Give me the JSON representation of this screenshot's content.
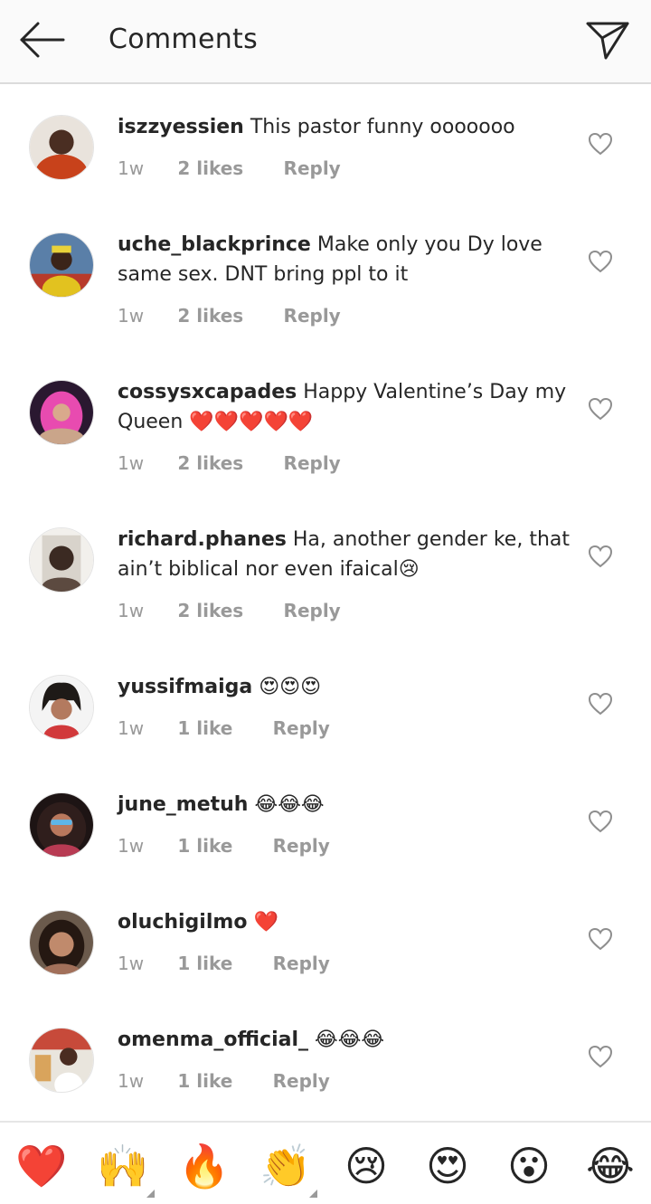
{
  "header": {
    "title": "Comments",
    "back_icon": "arrow-left-icon",
    "send_icon": "paper-plane-icon"
  },
  "comments": [
    {
      "username": "iszzyessien",
      "text": "This pastor funny ooooooo",
      "time": "1w",
      "likes": "2 likes",
      "reply": "Reply"
    },
    {
      "username": "uche_blackprince",
      "text": "Make only you Dy love same sex. DNT bring ppl to it",
      "time": "1w",
      "likes": "2 likes",
      "reply": "Reply"
    },
    {
      "username": "cossysxcapades",
      "text": "Happy Valentine’s Day my Queen ❤️❤️❤️❤️❤️",
      "time": "1w",
      "likes": "2 likes",
      "reply": "Reply"
    },
    {
      "username": "richard.phanes",
      "text": "Ha, another gender ke, that ain’t biblical nor even ifaical😢",
      "time": "1w",
      "likes": "2 likes",
      "reply": "Reply"
    },
    {
      "username": "yussifmaiga",
      "text": "😍😍😍",
      "time": "1w",
      "likes": "1 like",
      "reply": "Reply"
    },
    {
      "username": "june_metuh",
      "text": "😂😂😂",
      "time": "1w",
      "likes": "1 like",
      "reply": "Reply"
    },
    {
      "username": "oluchigilmo",
      "text": "❤️",
      "time": "1w",
      "likes": "1 like",
      "reply": "Reply"
    },
    {
      "username": "omenma_official_",
      "text": "😂😂😂",
      "time": "1w",
      "likes": "1 like",
      "reply": "Reply"
    }
  ],
  "emoji_bar": [
    "❤️",
    "🙌",
    "🔥",
    "👏",
    "😢",
    "😍",
    "😮",
    "😂"
  ],
  "colors": {
    "header_bg": "#fafafa",
    "text": "#262626",
    "meta": "#999999",
    "heart": "#ed4956"
  }
}
